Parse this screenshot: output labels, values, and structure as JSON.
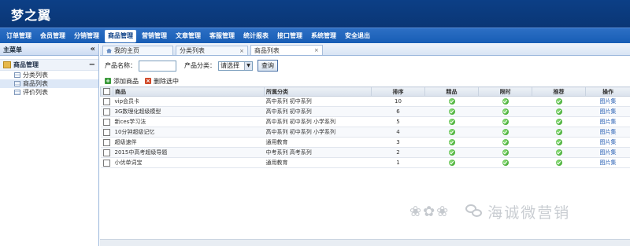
{
  "app": {
    "title": "梦之翼"
  },
  "nav": {
    "items": [
      "订单管理",
      "会员管理",
      "分销管理",
      "商品管理",
      "营销管理",
      "文章管理",
      "客服管理",
      "统计报表",
      "接口管理",
      "系统管理",
      "安全退出"
    ],
    "active_index": 3
  },
  "sidebar": {
    "title": "主菜单",
    "collapse_glyph": "«",
    "group": {
      "label": "商品管理",
      "toggle": "−"
    },
    "items": [
      "分类列表",
      "商品列表",
      "评价列表"
    ],
    "selected_index": 1
  },
  "tabs": {
    "items": [
      "我的主页",
      "分类列表",
      "商品列表"
    ],
    "active_index": 2,
    "close_glyph": "×"
  },
  "filter": {
    "name_label": "产品名称：",
    "name_value": "",
    "category_label": "产品分类：",
    "category_value": "请选择",
    "query_label": "查询"
  },
  "toolbar": {
    "add_label": "添加商品",
    "delete_label": "删除选中"
  },
  "table": {
    "headers": [
      "商品",
      "所属分类",
      "排序",
      "精品",
      "限时",
      "推荐",
      "操作"
    ],
    "action_label": "图片集",
    "rows": [
      {
        "name": "vip会员卡",
        "category": "高中系列  初中系列",
        "order": "10"
      },
      {
        "name": "3G数理化超级模型",
        "category": "高中系列  初中系列",
        "order": "6"
      },
      {
        "name": "新ces学习法",
        "category": "高中系列  初中系列  小学系列",
        "order": "5"
      },
      {
        "name": "10分钟超级记忆",
        "category": "高中系列  初中系列  小学系列",
        "order": "4"
      },
      {
        "name": "超级速伴",
        "category": "通用教育",
        "order": "3"
      },
      {
        "name": "2015中高考超级导题",
        "category": "中考系列  高考系列",
        "order": "2"
      },
      {
        "name": "小优单词宝",
        "category": "通用教育",
        "order": "1"
      }
    ]
  },
  "watermark": {
    "text": "海诚微营销",
    "flower": "❀✿❀"
  },
  "colors": {
    "header": "#0c3f86",
    "nav": "#1f64bb",
    "ok": "#2d9a1f",
    "link": "#2b62b5"
  }
}
